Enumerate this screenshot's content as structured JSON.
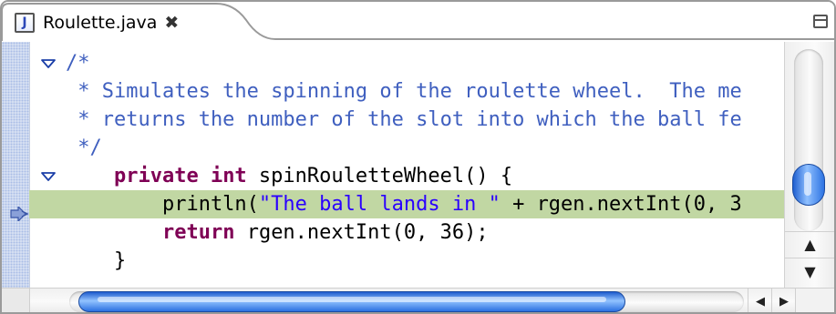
{
  "tab": {
    "title": "Roulette.java",
    "icon_letter": "J",
    "close_glyph": "✖"
  },
  "code": {
    "lines": [
      {
        "text": "/*",
        "style": "comment"
      },
      {
        "text": " * Simulates the spinning of the roulette wheel.  The me",
        "style": "comment"
      },
      {
        "text": " * returns the number of the slot into which the ball fe",
        "style": "comment"
      },
      {
        "text": " */",
        "style": "comment"
      },
      {
        "parts": [
          {
            "t": "    ",
            "c": "plain"
          },
          {
            "t": "private int",
            "c": "kw"
          },
          {
            "t": " spinRouletteWheel() {",
            "c": "plain"
          }
        ]
      },
      {
        "parts": [
          {
            "t": "        println(",
            "c": "plain"
          },
          {
            "t": "\"The ball lands in \"",
            "c": "str"
          },
          {
            "t": " + rgen.nextInt(0, 3",
            "c": "plain"
          }
        ]
      },
      {
        "parts": [
          {
            "t": "        ",
            "c": "plain"
          },
          {
            "t": "return",
            "c": "kw"
          },
          {
            "t": " rgen.nextInt(0, 36);",
            "c": "plain"
          }
        ]
      },
      {
        "parts": [
          {
            "t": "    }",
            "c": "plain"
          }
        ]
      }
    ]
  },
  "highlighted_line_index": 5,
  "colors": {
    "comment": "#3f5fbf",
    "keyword": "#7f0055",
    "string": "#2a00ff",
    "current_line": "#c1d7a3",
    "ruler": "#dfe6f4"
  },
  "icons": {
    "fold_markers": [
      "fold-toggle-icon",
      "fold-toggle-icon"
    ],
    "instruction_pointer": "debug-instruction-pointer-icon",
    "maximize": "maximize-icon",
    "scroll_up": "▲",
    "scroll_down": "▼",
    "scroll_left": "◀",
    "scroll_right": "▶"
  }
}
